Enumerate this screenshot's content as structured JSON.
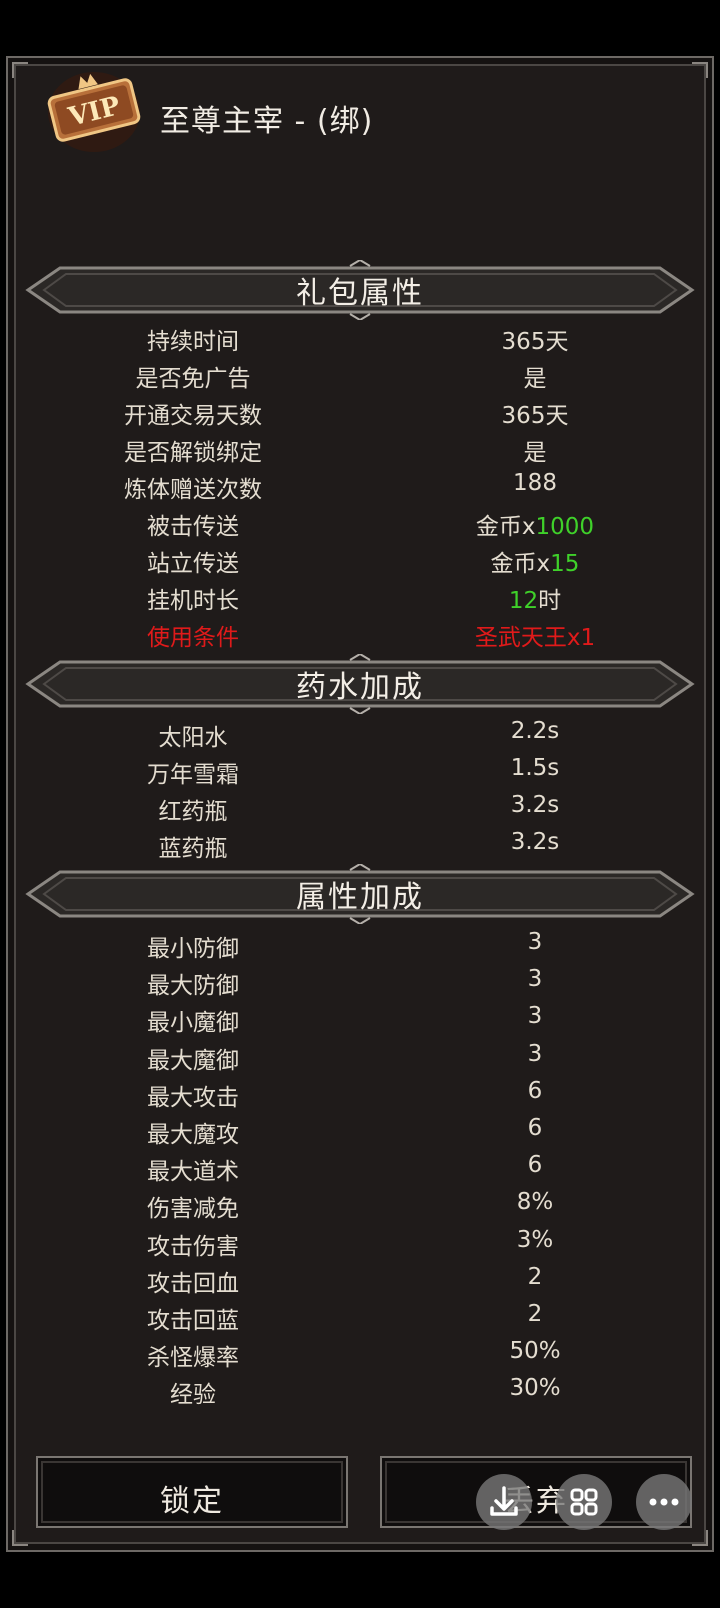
{
  "header": {
    "title": "至尊主宰 - (绑)",
    "icon": "vip-badge-icon",
    "icon_text": "VIP"
  },
  "sections": {
    "gift": "礼包属性",
    "potion": "药水加成",
    "attr": "属性加成"
  },
  "gift_rows": [
    {
      "k": "持续时间",
      "v": "365天"
    },
    {
      "k": "是否免广告",
      "v": "是"
    },
    {
      "k": "开通交易天数",
      "v": "365天"
    },
    {
      "k": "是否解锁绑定",
      "v": "是"
    },
    {
      "k": "炼体赠送次数",
      "v": "188"
    },
    {
      "k": "被击传送",
      "v_pre": "金币x",
      "v_num": "1000"
    },
    {
      "k": "站立传送",
      "v_pre": "金币x",
      "v_num": "15"
    },
    {
      "k": "挂机时长",
      "v_num": "12",
      "v_post": "时"
    },
    {
      "k": "使用条件",
      "v": "圣武天王x1"
    }
  ],
  "potion_rows": [
    {
      "k": "太阳水",
      "v": "2.2s"
    },
    {
      "k": "万年雪霜",
      "v": "1.5s"
    },
    {
      "k": "红药瓶",
      "v": "3.2s"
    },
    {
      "k": "蓝药瓶",
      "v": "3.2s"
    }
  ],
  "attr_rows": [
    {
      "k": "最小防御",
      "v": "3"
    },
    {
      "k": "最大防御",
      "v": "3"
    },
    {
      "k": "最小魔御",
      "v": "3"
    },
    {
      "k": "最大魔御",
      "v": "3"
    },
    {
      "k": "最大攻击",
      "v": "6"
    },
    {
      "k": "最大魔攻",
      "v": "6"
    },
    {
      "k": "最大道术",
      "v": "6"
    },
    {
      "k": "伤害减免",
      "v": "8%"
    },
    {
      "k": "攻击伤害",
      "v": "3%"
    },
    {
      "k": "攻击回血",
      "v": "2"
    },
    {
      "k": "攻击回蓝",
      "v": "2"
    },
    {
      "k": "杀怪爆率",
      "v": "50%"
    },
    {
      "k": "经验",
      "v": "30%"
    }
  ],
  "buttons": {
    "lock": "锁定",
    "drop": "丢弃"
  },
  "overlay": {
    "download": "download-icon",
    "grid": "grid-icon",
    "more": "more-icon"
  },
  "colors": {
    "red": "#e01a1a",
    "green": "#3fd12a",
    "panel": "#1f1b1a"
  }
}
